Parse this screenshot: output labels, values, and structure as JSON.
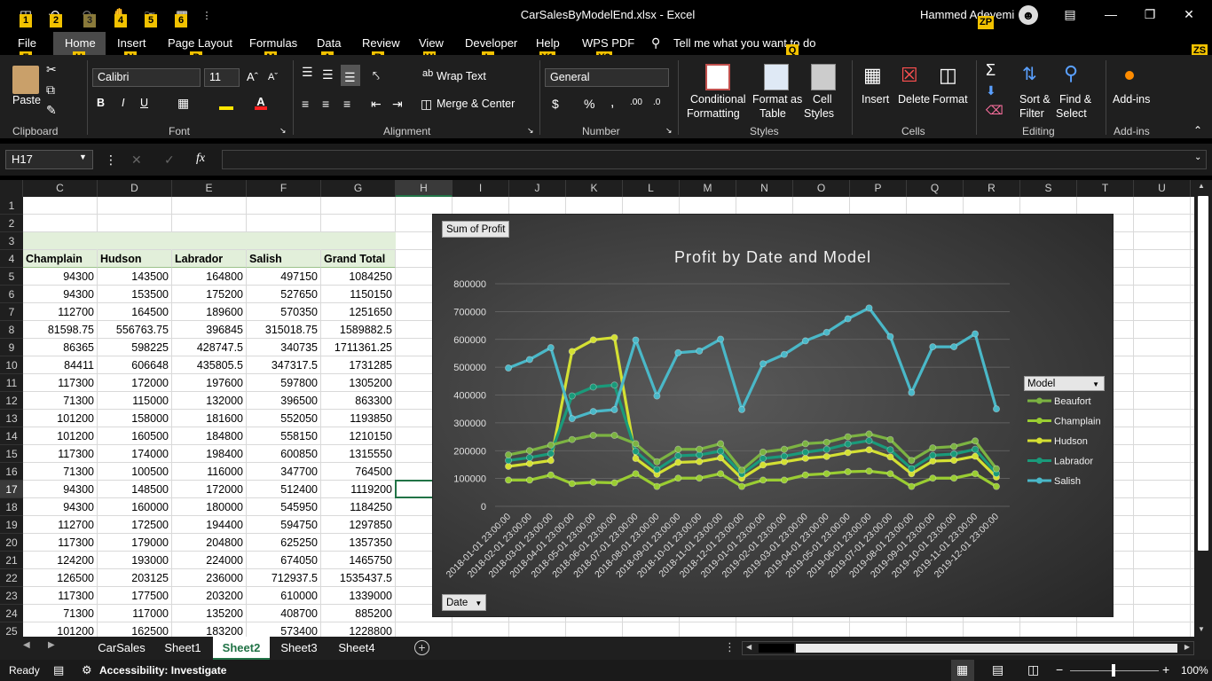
{
  "title": {
    "window_title": "CarSalesByModelEnd.xlsx  -  Excel",
    "user": "Hammed Adeyemi"
  },
  "keytips": {
    "qat": [
      "1",
      "2",
      "3",
      "4",
      "5",
      "6"
    ],
    "file": "F",
    "home": "H",
    "insert": "N",
    "pagelayout": "P",
    "formulas": "M",
    "data": "A",
    "review": "R",
    "view": "W",
    "developer": "L",
    "help": "Y1",
    "wpspdf": "Y2",
    "tellme": "Q",
    "zp": "ZP",
    "zs": "ZS"
  },
  "menu": {
    "file": "File",
    "home": "Home",
    "insert": "Insert",
    "pagelayout": "Page Layout",
    "formulas": "Formulas",
    "data": "Data",
    "review": "Review",
    "view": "View",
    "developer": "Developer",
    "help": "Help",
    "wpspdf": "WPS PDF",
    "tellme": "Tell me what you want to do"
  },
  "ribbon": {
    "groups": {
      "clipboard": "Clipboard",
      "font": "Font",
      "alignment": "Alignment",
      "number": "Number",
      "styles": "Styles",
      "cells": "Cells",
      "editing": "Editing",
      "addins": "Add-ins"
    },
    "paste": "Paste",
    "font_name": "Calibri",
    "font_size": "11",
    "bold": "B",
    "italic": "I",
    "underline": "U",
    "wrap_text": "Wrap Text",
    "merge_center": "Merge & Center",
    "number_format": "General",
    "currency": "$",
    "percent": "%",
    "comma": ",",
    "cond_format": "Conditional",
    "cond_format2": "Formatting",
    "format_table": "Format as",
    "format_table2": "Table",
    "cell_styles": "Cell",
    "cell_styles2": "Styles",
    "insert": "Insert",
    "delete": "Delete",
    "format": "Format",
    "sort_filter": "Sort &",
    "sort_filter2": "Filter",
    "find_select": "Find &",
    "find_select2": "Select",
    "addins": "Add-ins",
    "accent_color": "#217346"
  },
  "formula_bar": {
    "name_box": "H17",
    "fx": "fx",
    "value": ""
  },
  "columns": [
    "C",
    "D",
    "E",
    "F",
    "G",
    "H",
    "I",
    "J",
    "K",
    "L",
    "M",
    "N",
    "O",
    "P",
    "Q",
    "R",
    "S",
    "T",
    "U"
  ],
  "rows": [
    "1",
    "2",
    "3",
    "4",
    "5",
    "6",
    "7",
    "8",
    "9",
    "10",
    "11",
    "12",
    "13",
    "14",
    "15",
    "16",
    "17",
    "18",
    "19",
    "20",
    "21",
    "22",
    "23",
    "24",
    "25"
  ],
  "table": {
    "headers": [
      "Champlain",
      "Hudson",
      "Labrador",
      "Salish",
      "Grand Total"
    ],
    "data": [
      [
        "94300",
        "143500",
        "164800",
        "497150",
        "1084250"
      ],
      [
        "94300",
        "153500",
        "175200",
        "527650",
        "1150150"
      ],
      [
        "112700",
        "164500",
        "189600",
        "570350",
        "1251650"
      ],
      [
        "81598.75",
        "556763.75",
        "396845",
        "315018.75",
        "1589882.5"
      ],
      [
        "86365",
        "598225",
        "428747.5",
        "340735",
        "1711361.25"
      ],
      [
        "84411",
        "606648",
        "435805.5",
        "347317.5",
        "1731285"
      ],
      [
        "117300",
        "172000",
        "197600",
        "597800",
        "1305200"
      ],
      [
        "71300",
        "115000",
        "132000",
        "396500",
        "863300"
      ],
      [
        "101200",
        "158000",
        "181600",
        "552050",
        "1193850"
      ],
      [
        "101200",
        "160500",
        "184800",
        "558150",
        "1210150"
      ],
      [
        "117300",
        "174000",
        "198400",
        "600850",
        "1315550"
      ],
      [
        "71300",
        "100500",
        "116000",
        "347700",
        "764500"
      ],
      [
        "94300",
        "148500",
        "172000",
        "512400",
        "1119200"
      ],
      [
        "94300",
        "160000",
        "180000",
        "545950",
        "1184250"
      ],
      [
        "112700",
        "172500",
        "194400",
        "594750",
        "1297850"
      ],
      [
        "117300",
        "179000",
        "204800",
        "625250",
        "1357350"
      ],
      [
        "124200",
        "193000",
        "224000",
        "674050",
        "1465750"
      ],
      [
        "126500",
        "203125",
        "236000",
        "712937.5",
        "1535437.5"
      ],
      [
        "117300",
        "177500",
        "203200",
        "610000",
        "1339000"
      ],
      [
        "71300",
        "117000",
        "135200",
        "408700",
        "885200"
      ],
      [
        "101200",
        "162500",
        "183200",
        "573400",
        "1228800"
      ]
    ]
  },
  "chart_data": {
    "type": "line",
    "title": "Profit by Date and Model",
    "field_button_value": "Sum of Profit",
    "field_button_axis": "Date",
    "legend_title": "Model",
    "legend_position": "right",
    "ylim": [
      0,
      800000
    ],
    "yticks": [
      "800000",
      "700000",
      "600000",
      "500000",
      "400000",
      "300000",
      "200000",
      "100000",
      "0"
    ],
    "x": [
      "2018-01-01 23:00:00",
      "2018-02-01 23:00:00",
      "2018-03-01 23:00:00",
      "2018-04-01 23:00:00",
      "2018-05-01 23:00:00",
      "2018-06-01 23:00:00",
      "2018-07-01 23:00:00",
      "2018-08-01 23:00:00",
      "2018-09-01 23:00:00",
      "2018-10-01 23:00:00",
      "2018-11-01 23:00:00",
      "2018-12-01 23:00:00",
      "2019-01-01 23:00:00",
      "2019-02-01 23:00:00",
      "2019-03-01 23:00:00",
      "2019-04-01 23:00:00",
      "2019-05-01 23:00:00",
      "2019-06-01 23:00:00",
      "2019-07-01 23:00:00",
      "2019-08-01 23:00:00",
      "2019-09-01 23:00:00",
      "2019-10-01 23:00:00",
      "2019-11-01 23:00:00",
      "2019-12-01 23:00:00"
    ],
    "series": [
      {
        "name": "Beaufort",
        "color": "#7cb342",
        "values": [
          185000,
          200000,
          220000,
          240000,
          255000,
          255000,
          225000,
          160000,
          205000,
          205000,
          225000,
          130000,
          195000,
          205000,
          225000,
          230000,
          250000,
          260000,
          240000,
          165000,
          210000,
          215000,
          235000,
          135000
        ]
      },
      {
        "name": "Champlain",
        "color": "#9acd32",
        "values": [
          94300,
          94300,
          112700,
          81598.75,
          86365,
          84411,
          117300,
          71300,
          101200,
          101200,
          117300,
          71300,
          94300,
          94300,
          112700,
          117300,
          124200,
          126500,
          117300,
          71300,
          101200,
          101200,
          117300,
          71300
        ]
      },
      {
        "name": "Hudson",
        "color": "#d4e033",
        "values": [
          143500,
          153500,
          164500,
          556763.75,
          598225,
          606648,
          172000,
          115000,
          158000,
          160500,
          174000,
          100500,
          148500,
          160000,
          172500,
          179000,
          193000,
          203125,
          177500,
          117000,
          162500,
          165000,
          180000,
          105000
        ]
      },
      {
        "name": "Labrador",
        "color": "#1a9a7a",
        "values": [
          164800,
          175200,
          189600,
          396845,
          428747.5,
          435805.5,
          197600,
          132000,
          181600,
          184800,
          198400,
          116000,
          172000,
          180000,
          194400,
          204800,
          224000,
          236000,
          203200,
          135200,
          183200,
          188000,
          205000,
          118000
        ]
      },
      {
        "name": "Salish",
        "color": "#4ab8c8",
        "values": [
          497150,
          527650,
          570350,
          315018.75,
          340735,
          347317.5,
          597800,
          396500,
          552050,
          558150,
          600850,
          347700,
          512400,
          545950,
          594750,
          625250,
          674050,
          712937.5,
          610000,
          408700,
          573400,
          573400,
          620000,
          350000
        ]
      }
    ]
  },
  "sheets": [
    "CarSales",
    "Sheet1",
    "Sheet2",
    "Sheet3",
    "Sheet4"
  ],
  "active_sheet": "Sheet2",
  "status": {
    "ready": "Ready",
    "accessibility": "Accessibility: Investigate",
    "zoom": "100%",
    "minus": "−",
    "plus": "+"
  }
}
